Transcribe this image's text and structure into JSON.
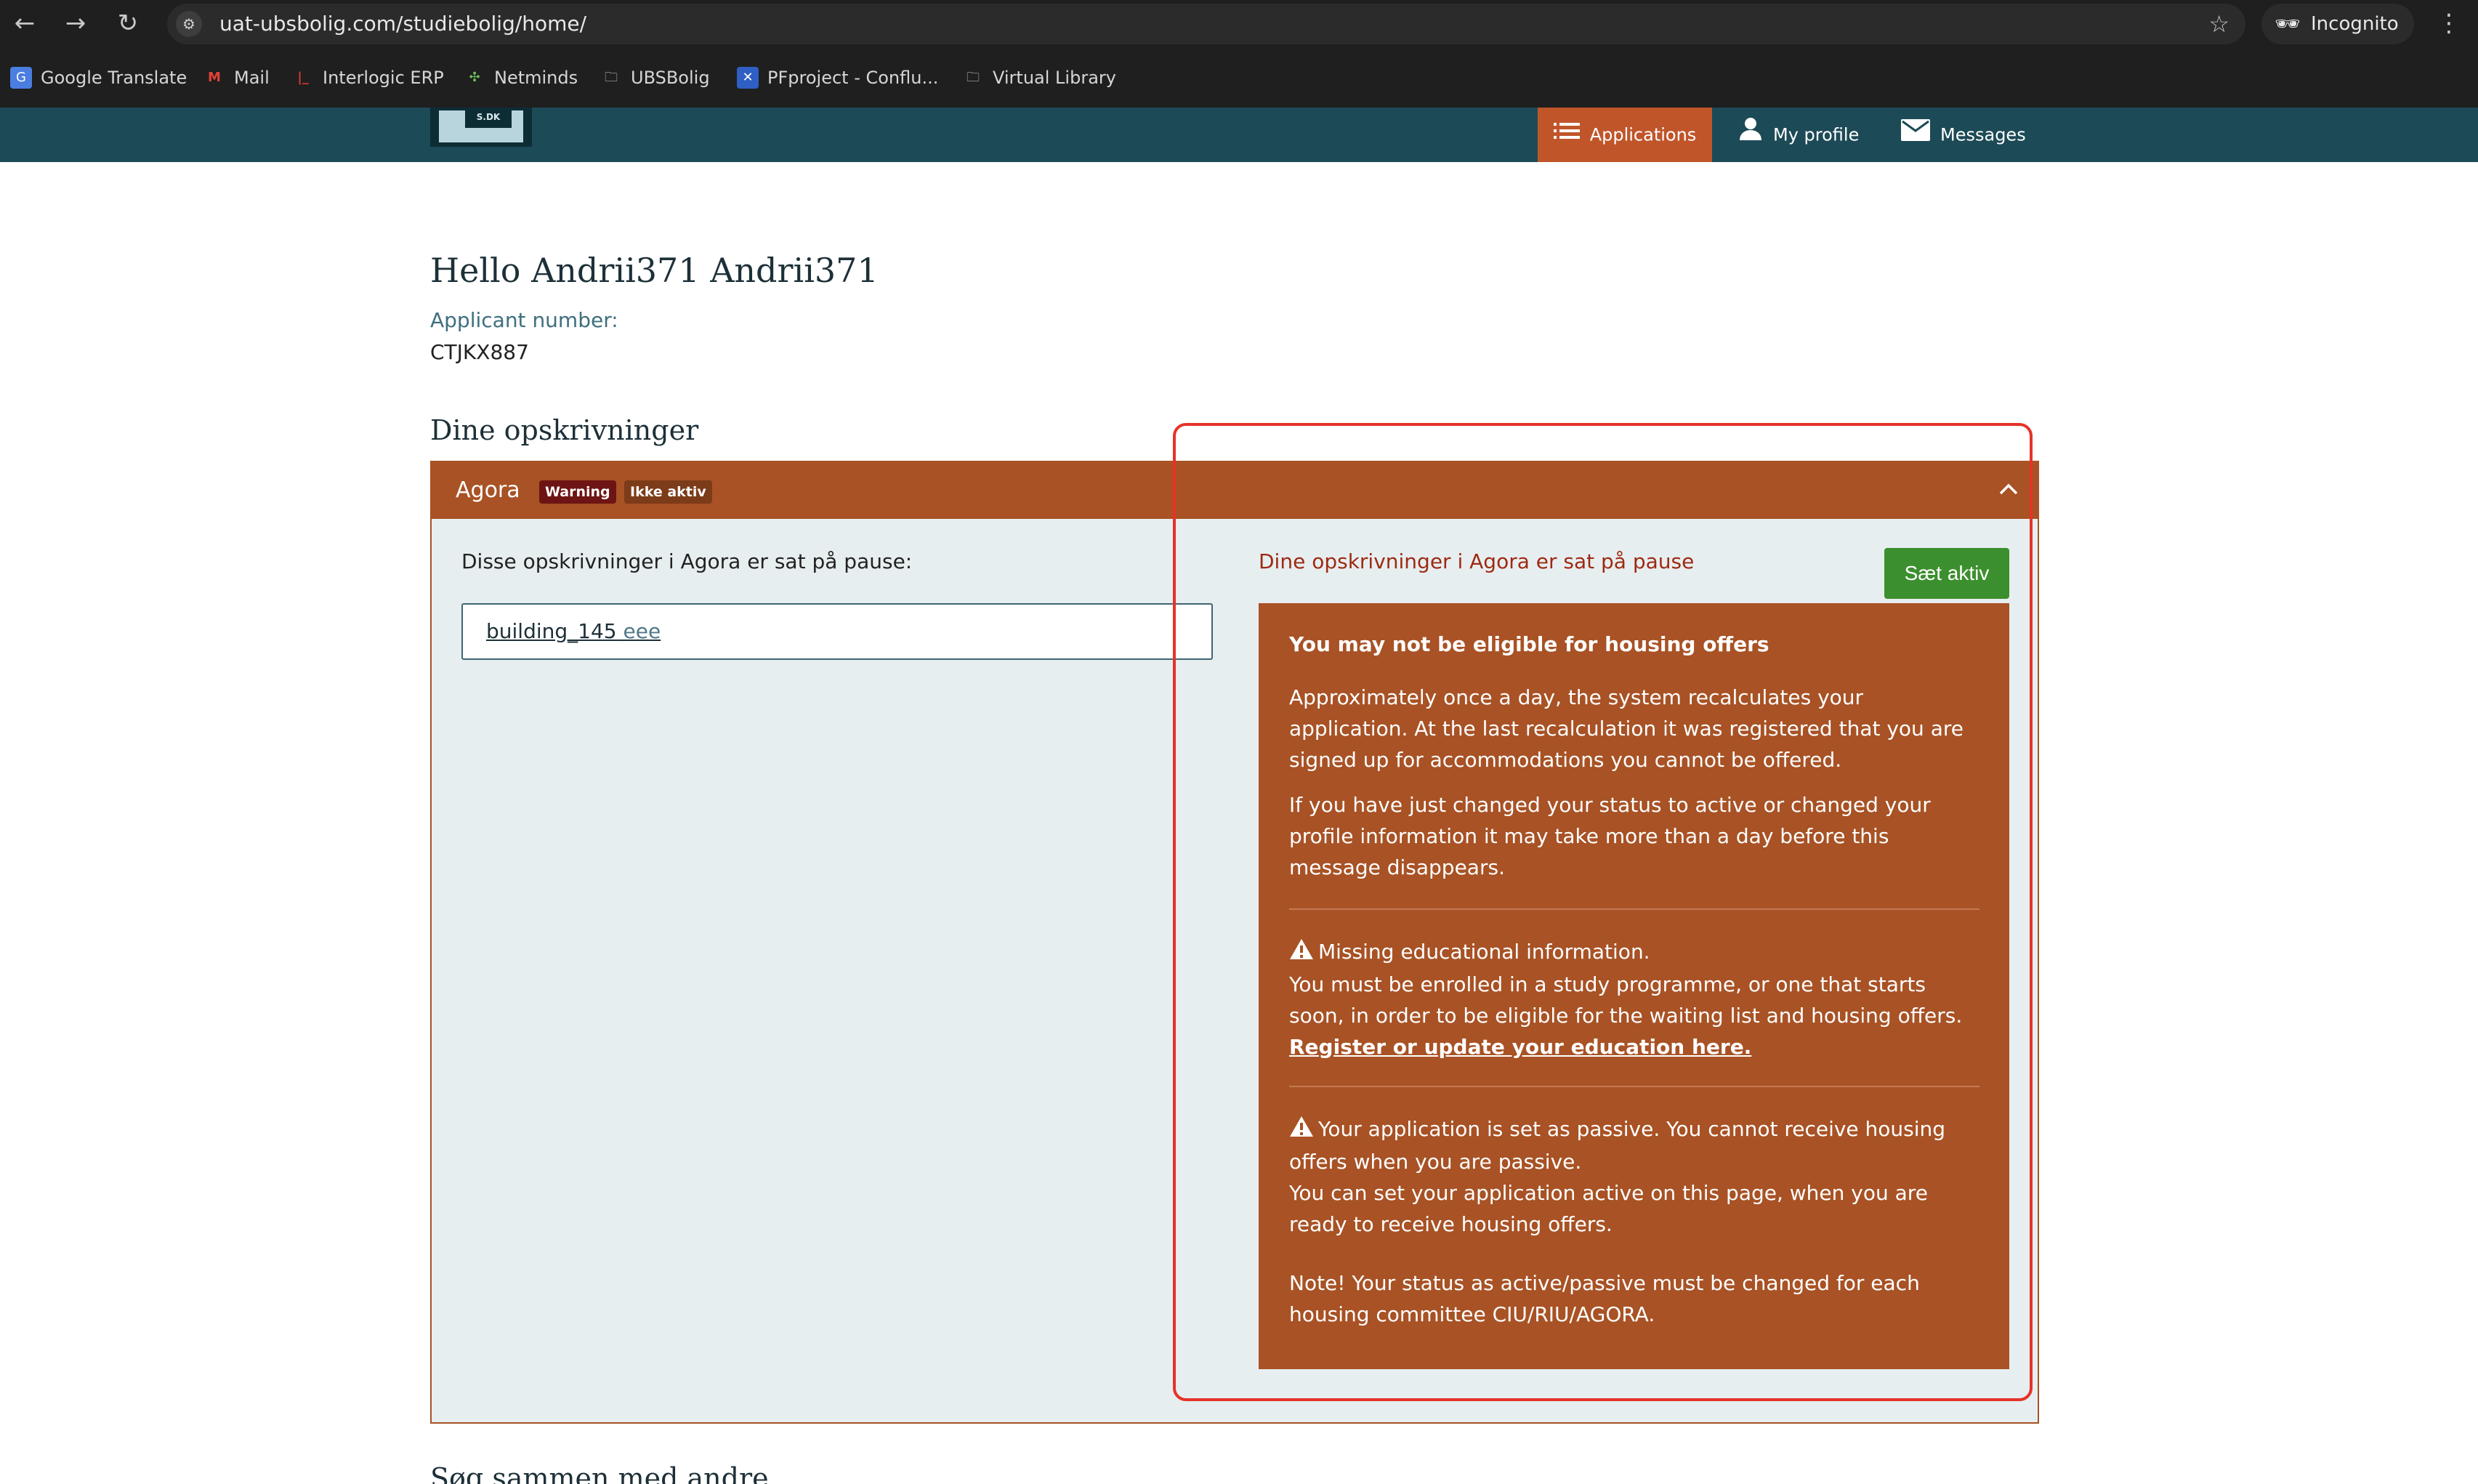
{
  "browser": {
    "url": "uat-ubsbolig.com/studiebolig/home/",
    "profile_label": "Incognito",
    "bookmarks": [
      {
        "label": "Google Translate",
        "icon": "google-translate-icon"
      },
      {
        "label": "Mail",
        "icon": "gmail-icon"
      },
      {
        "label": "Interlogic ERP",
        "icon": "interlogic-icon"
      },
      {
        "label": "Netminds",
        "icon": "netminds-icon"
      },
      {
        "label": "UBSBolig",
        "icon": "folder-icon"
      },
      {
        "label": "PFproject - Conflu...",
        "icon": "confluence-icon"
      },
      {
        "label": "Virtual Library",
        "icon": "folder-icon"
      }
    ]
  },
  "site": {
    "logo_text": "S.DK",
    "nav": {
      "applications": "Applications",
      "profile": "My profile",
      "messages": "Messages"
    },
    "accent": "#a85225",
    "header_color": "#1c4a56"
  },
  "page": {
    "greeting": "Hello Andrii371 Andrii371",
    "applicant_label": "Applicant number:",
    "applicant_number": "CTJKX887",
    "section_title": "Dine opskrivninger",
    "next_section_title": "Søg sammen med andre"
  },
  "panel": {
    "title": "Agora",
    "badge_warning": "Warning",
    "badge_inactive": "Ikke aktiv",
    "paused_text": "Disse opskrivninger i Agora er sat på pause:",
    "building_name": "building_145",
    "building_sub": "eee",
    "paused_notice": "Dine opskrivninger i Agora er sat på pause",
    "activate_button": "Sæt aktiv"
  },
  "warning_box": {
    "title": "You may not be eligible for housing offers",
    "p1": "Approximately once a day, the system recalculates your application. At the last recalculation it was registered that you are signed up for accommodations you cannot be offered.",
    "p2": "If you have just changed your status to active or changed your profile information it may take more than a day before this message disappears.",
    "w1_line1": "Missing educational information.",
    "w1_line2": "You must be enrolled in a study programme, or one that starts soon, in order to be eligible for the waiting list and housing offers.",
    "w1_link": "Register or update your education here.",
    "w2_line1": "Your application is set as passive. You cannot receive housing offers when you are passive.",
    "w2_line2": "You can set your application active on this page, when you are ready to receive housing offers.",
    "note": "Note! Your status as active/passive must be changed for each housing committee CIU/RIU/AGORA."
  }
}
